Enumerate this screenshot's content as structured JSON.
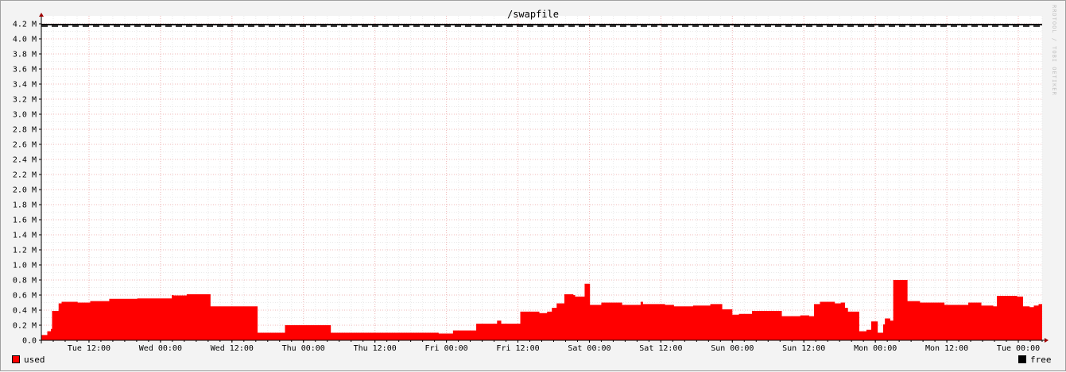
{
  "title": "/swapfile",
  "watermark": "RRDTOOL / TOBI OETIKER",
  "legend": [
    {
      "label": "used",
      "color": "#ff0000"
    },
    {
      "label": "free",
      "color": "#000000"
    }
  ],
  "chart_data": {
    "type": "area",
    "title": "/swapfile",
    "xlabel": "",
    "ylabel": "",
    "ylim": [
      0,
      4200000
    ],
    "y_ticks": [
      {
        "value": 0,
        "label": "0.0"
      },
      {
        "value": 200000,
        "label": "0.2 M"
      },
      {
        "value": 400000,
        "label": "0.4 M"
      },
      {
        "value": 600000,
        "label": "0.6 M"
      },
      {
        "value": 800000,
        "label": "0.8 M"
      },
      {
        "value": 1000000,
        "label": "1.0 M"
      },
      {
        "value": 1200000,
        "label": "1.2 M"
      },
      {
        "value": 1400000,
        "label": "1.4 M"
      },
      {
        "value": 1600000,
        "label": "1.6 M"
      },
      {
        "value": 1800000,
        "label": "1.8 M"
      },
      {
        "value": 2000000,
        "label": "2.0 M"
      },
      {
        "value": 2200000,
        "label": "2.2 M"
      },
      {
        "value": 2400000,
        "label": "2.4 M"
      },
      {
        "value": 2600000,
        "label": "2.6 M"
      },
      {
        "value": 2800000,
        "label": "2.8 M"
      },
      {
        "value": 3000000,
        "label": "3.0 M"
      },
      {
        "value": 3200000,
        "label": "3.2 M"
      },
      {
        "value": 3400000,
        "label": "3.4 M"
      },
      {
        "value": 3600000,
        "label": "3.6 M"
      },
      {
        "value": 3800000,
        "label": "3.8 M"
      },
      {
        "value": 4000000,
        "label": "4.0 M"
      },
      {
        "value": 4200000,
        "label": "4.2 M"
      }
    ],
    "xlim": [
      0,
      168
    ],
    "x_unit": "hours",
    "x_ticks": [
      {
        "value": 8,
        "label": "Tue 12:00"
      },
      {
        "value": 20,
        "label": "Wed 00:00"
      },
      {
        "value": 32,
        "label": "Wed 12:00"
      },
      {
        "value": 44,
        "label": "Thu 00:00"
      },
      {
        "value": 56,
        "label": "Thu 12:00"
      },
      {
        "value": 68,
        "label": "Fri 00:00"
      },
      {
        "value": 80,
        "label": "Fri 12:00"
      },
      {
        "value": 92,
        "label": "Sat 00:00"
      },
      {
        "value": 104,
        "label": "Sat 12:00"
      },
      {
        "value": 116,
        "label": "Sun 00:00"
      },
      {
        "value": 128,
        "label": "Sun 12:00"
      },
      {
        "value": 140,
        "label": "Mon 00:00"
      },
      {
        "value": 152,
        "label": "Mon 12:00"
      },
      {
        "value": 164,
        "label": "Tue 00:00"
      }
    ],
    "grid": true,
    "legend_position": "bottom",
    "series": [
      {
        "name": "used",
        "color": "#ff0000",
        "type": "area",
        "x": [
          0,
          1,
          1.6,
          1.8,
          2.9,
          3.4,
          6.1,
          8.2,
          11.4,
          16.1,
          21.9,
          22.2,
          24.4,
          26.6,
          28.4,
          33.4,
          36.3,
          36.8,
          40.9,
          41.3,
          48.6,
          49.3,
          57.2,
          62.3,
          66.7,
          69.1,
          71.6,
          73.0,
          76.5,
          77.2,
          78.3,
          80.4,
          83.6,
          84.9,
          85.7,
          86.5,
          87.8,
          88.8,
          89.3,
          89.6,
          91.2,
          92.1,
          94.0,
          97.5,
          100.6,
          101.0,
          104.7,
          106.2,
          109.4,
          112.3,
          114.3,
          116.0,
          117.1,
          119.3,
          121.0,
          124.3,
          127.4,
          128.9,
          129.7,
          130.7,
          133.2,
          134.2,
          134.9,
          135.4,
          137.3,
          138.5,
          139.3,
          140.4,
          141.3,
          141.6,
          142.5,
          143.0,
          145.4,
          147.5,
          151.6,
          155.1,
          155.6,
          157.8,
          159.8,
          160.4,
          163.8,
          164.8,
          165.9,
          166.1,
          166.6,
          167.4,
          168
        ],
        "values": [
          70000,
          120000,
          150000,
          390000,
          490000,
          510000,
          500000,
          520000,
          550000,
          555000,
          600000,
          595000,
          610000,
          610000,
          450000,
          450000,
          100000,
          100000,
          200000,
          200000,
          100000,
          100000,
          100000,
          100000,
          90000,
          130000,
          130000,
          220000,
          260000,
          220000,
          220000,
          380000,
          360000,
          380000,
          430000,
          490000,
          610000,
          610000,
          600000,
          580000,
          750000,
          470000,
          500000,
          470000,
          510000,
          480000,
          470000,
          450000,
          460000,
          480000,
          410000,
          340000,
          350000,
          390000,
          390000,
          320000,
          330000,
          320000,
          480000,
          510000,
          490000,
          500000,
          430000,
          380000,
          120000,
          140000,
          250000,
          100000,
          210000,
          290000,
          260000,
          800000,
          520000,
          500000,
          470000,
          470000,
          500000,
          460000,
          450000,
          590000,
          580000,
          450000,
          440000,
          440000,
          460000,
          480000,
          500000
        ]
      },
      {
        "name": "free",
        "color": "#000000",
        "type": "line",
        "note_total": "4.2 M",
        "x": [
          0,
          168
        ],
        "values": [
          4190000,
          4190000
        ]
      }
    ]
  }
}
